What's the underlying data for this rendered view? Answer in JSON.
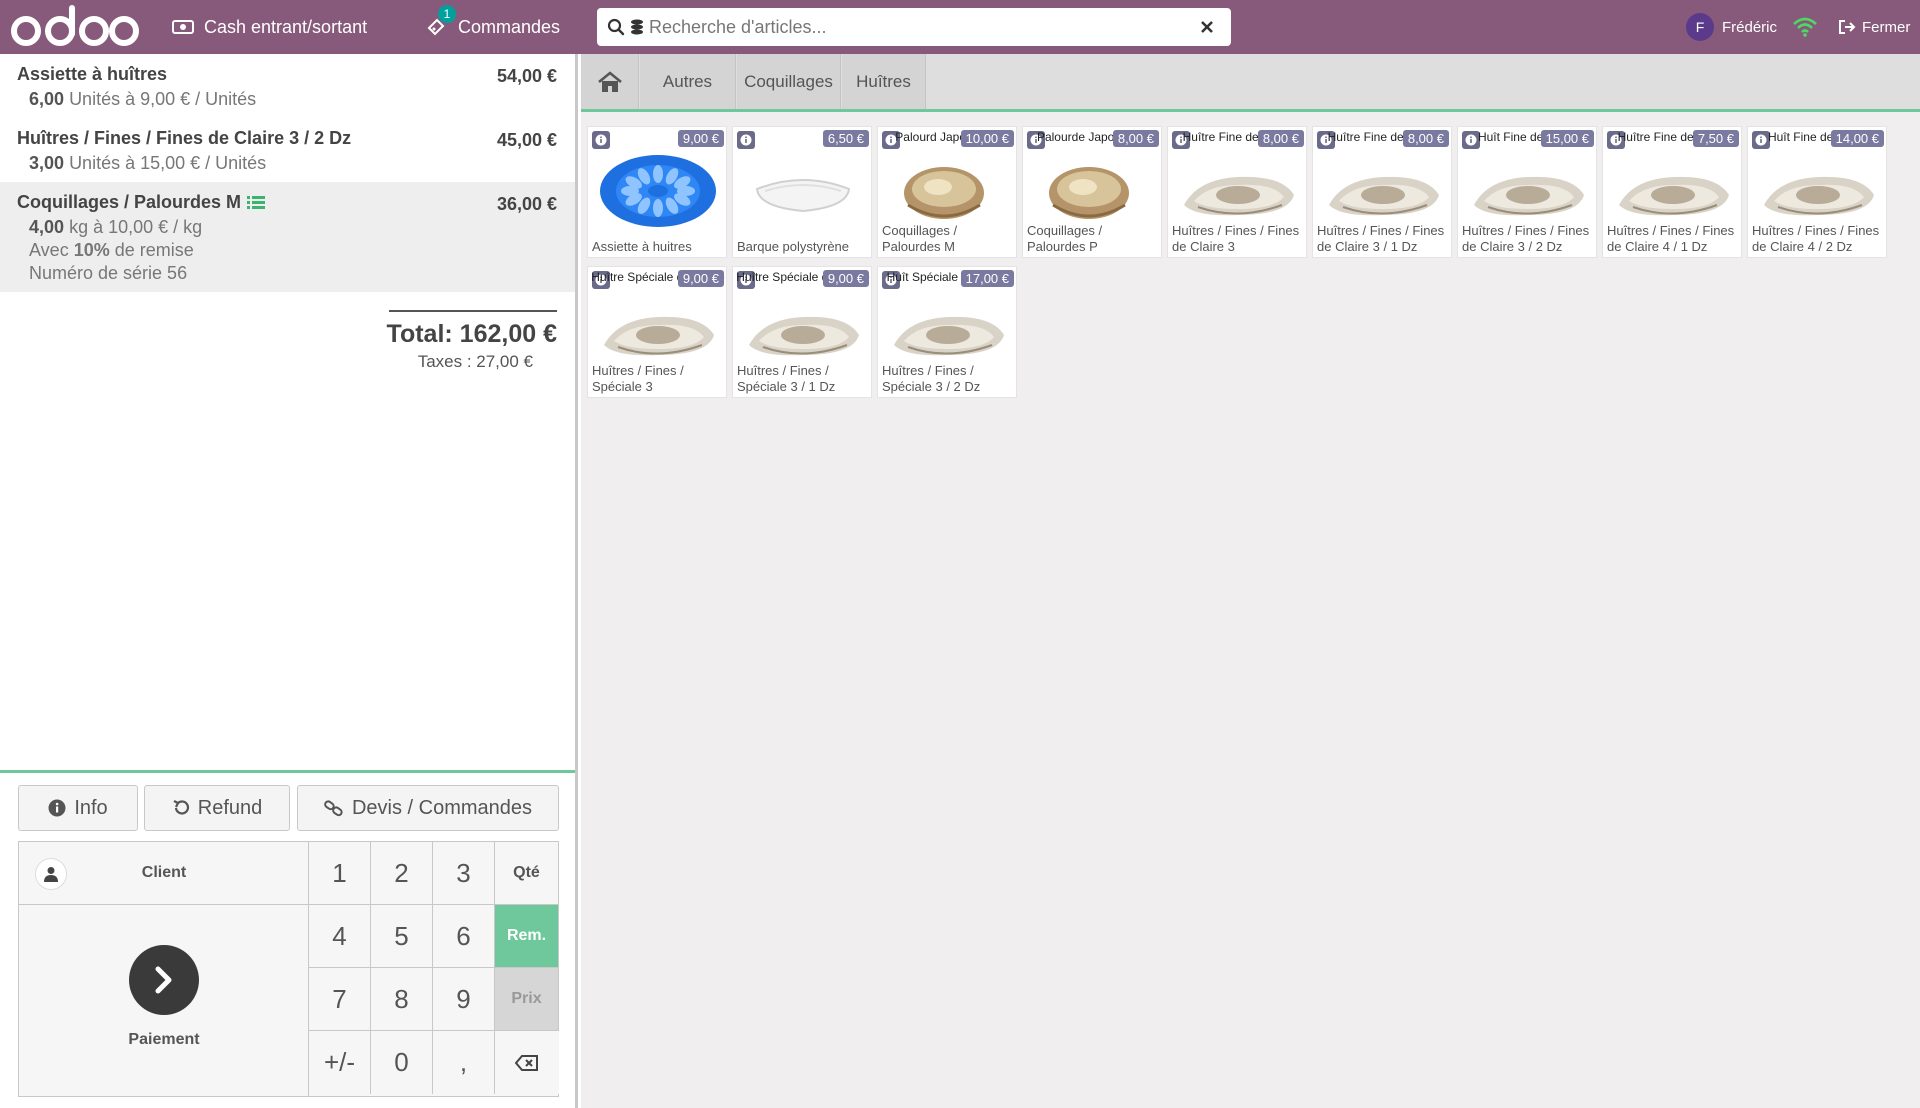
{
  "topbar": {
    "logo_text": "odoo",
    "cash_label": "Cash entrant/sortant",
    "orders_label": "Commandes",
    "orders_badge": "1",
    "search_placeholder": "Recherche d'articles...",
    "user_initial": "F",
    "user_name": "Frédéric",
    "close_label": "Fermer",
    "accent": "#875a7b"
  },
  "order": {
    "lines": [
      {
        "name": "Assiette à huîtres",
        "price": "54,00 €",
        "qty": "6,00",
        "unit_info": "Unités à 9,00 € / Unités"
      },
      {
        "name": "Huîtres / Fines / Fines de Claire 3 / 2 Dz",
        "price": "45,00 €",
        "qty": "3,00",
        "unit_info": "Unités à 15,00 € / Unités"
      },
      {
        "name": "Coquillages / Palourdes M",
        "price": "36,00 €",
        "qty": "4,00",
        "unit_info": "kg à 10,00 € / kg",
        "discount_prefix": "Avec",
        "discount": "10%",
        "discount_suffix": "de remise",
        "serial": "Numéro de série 56"
      }
    ],
    "total": "Total: 162,00 €",
    "taxes": "Taxes : 27,00 €"
  },
  "controls": {
    "info_label": "Info",
    "refund_label": "Refund",
    "quotes_label": "Devis / Commandes",
    "client_label": "Client",
    "payment_label": "Paiement",
    "keys": {
      "k1": "1",
      "k2": "2",
      "k3": "3",
      "qty": "Qté",
      "k4": "4",
      "k5": "5",
      "k6": "6",
      "disc": "Rem.",
      "k7": "7",
      "k8": "8",
      "k9": "9",
      "price": "Prix",
      "sign": "+/-",
      "k0": "0",
      "comma": ","
    }
  },
  "categories": [
    "Autres",
    "Coquillages",
    "Huîtres"
  ],
  "products": [
    {
      "name": "Assiette à huitres",
      "price": "9,00 €",
      "img": "plate",
      "img_text": ""
    },
    {
      "name": "Barque polystyrène",
      "price": "6,50 €",
      "img": "tray",
      "img_text": ""
    },
    {
      "name": "Coquillages / Palourdes M",
      "price": "10,00 €",
      "img": "clam",
      "img_text": "Palourd Japonaises"
    },
    {
      "name": "Coquillages / Palourdes P",
      "price": "8,00 €",
      "img": "clam",
      "img_text": "Palourde Japonaises"
    },
    {
      "name": "Huîtres / Fines / Fines de Claire 3",
      "price": "8,00 €",
      "img": "oyster",
      "img_text": "Huître Fine de Claire"
    },
    {
      "name": "Huîtres / Fines / Fines de Claire 3 / 1 Dz",
      "price": "8,00 €",
      "img": "oyster",
      "img_text": "Huître Fine de Claire"
    },
    {
      "name": "Huîtres / Fines / Fines de Claire 3 / 2 Dz",
      "price": "15,00 €",
      "img": "oyster",
      "img_text": "Huît Fine de Claire"
    },
    {
      "name": "Huîtres / Fines / Fines de Claire 4 / 1 Dz",
      "price": "7,50 €",
      "img": "oyster",
      "img_text": "Huître Fine de Claire"
    },
    {
      "name": "Huîtres / Fines / Fines de Claire 4 / 2 Dz",
      "price": "14,00 €",
      "img": "oyster",
      "img_text": "Huît Fine de Claire"
    },
    {
      "name": "Huîtres / Fines / Spéciale 3",
      "price": "9,00 €",
      "img": "oyster",
      "img_text": "Huître Spéciale de Claire"
    },
    {
      "name": "Huîtres / Fines / Spéciale 3 / 1 Dz",
      "price": "9,00 €",
      "img": "oyster",
      "img_text": "Huître Spéciale de Claire"
    },
    {
      "name": "Huîtres / Fines / Spéciale 3 / 2 Dz",
      "price": "17,00 €",
      "img": "oyster",
      "img_text": "Huît Spéciale de Claire"
    }
  ]
}
